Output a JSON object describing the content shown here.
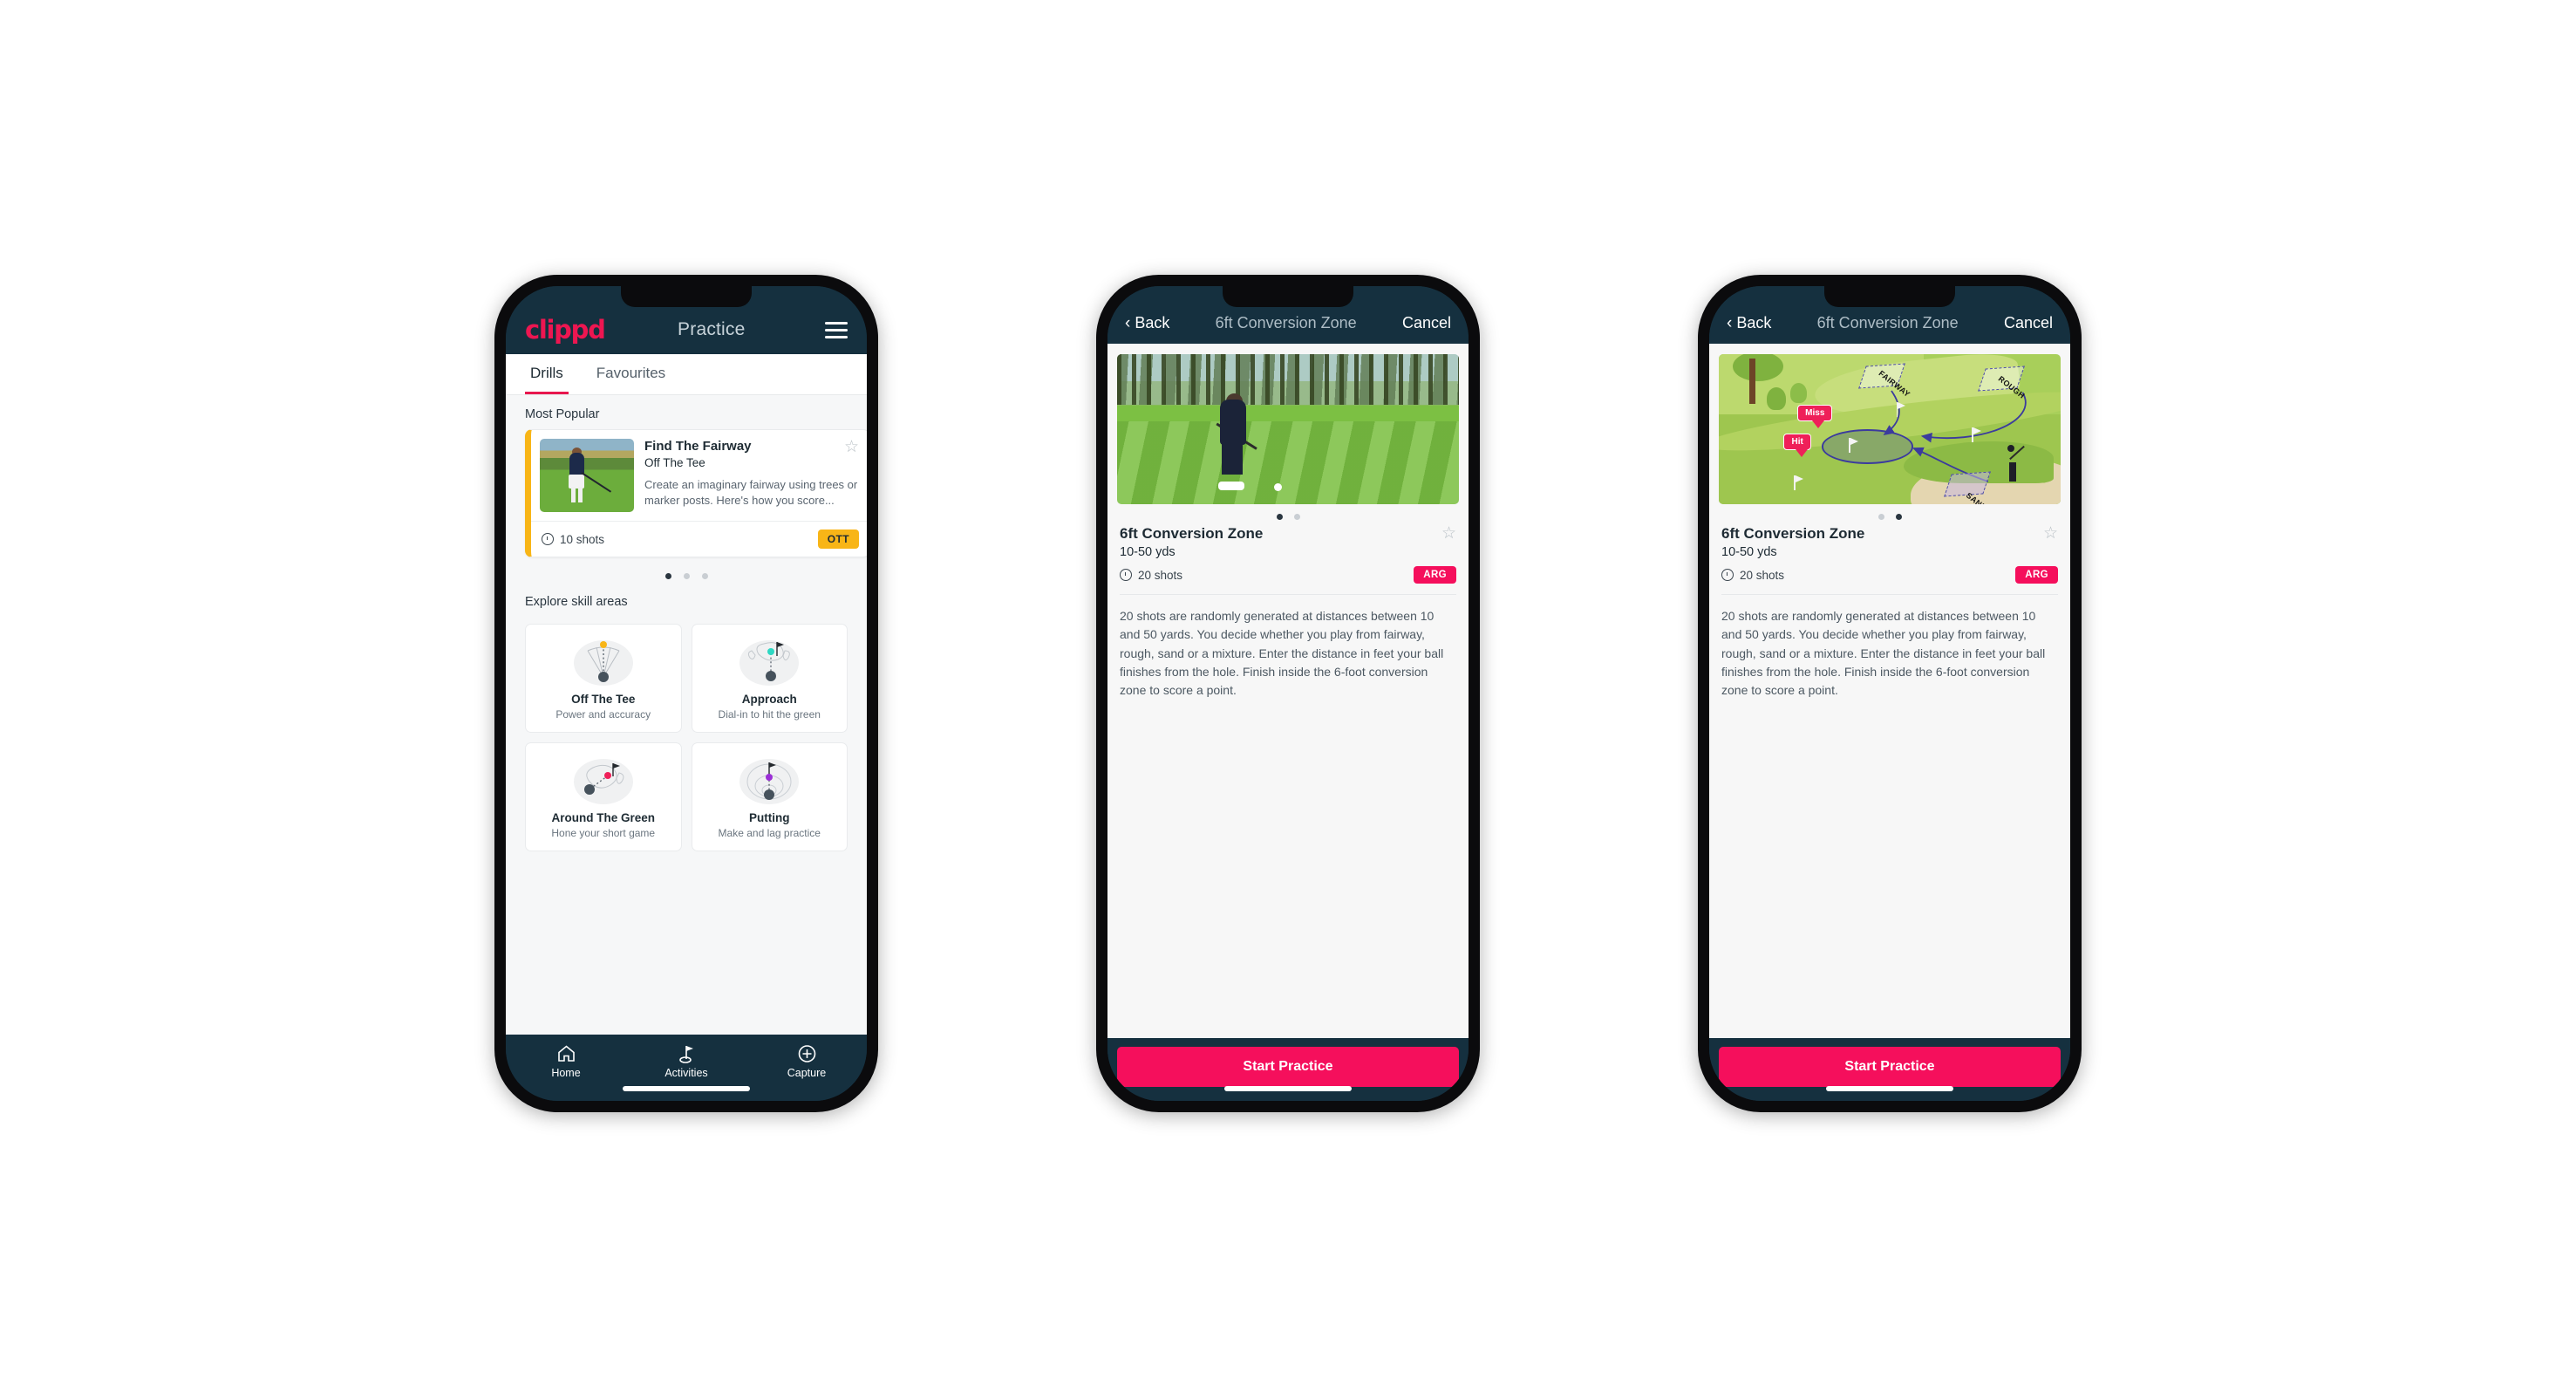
{
  "phone1": {
    "header": {
      "logo": "clippd",
      "title": "Practice",
      "menu_icon": "hamburger-menu-icon"
    },
    "tabs": [
      {
        "label": "Drills",
        "active": true
      },
      {
        "label": "Favourites",
        "active": false
      }
    ],
    "most_popular_label": "Most Popular",
    "drill_card": {
      "title": "Find The Fairway",
      "subtitle": "Off The Tee",
      "description": "Create an imaginary fairway using trees or marker posts. Here's how you score...",
      "shots": "10 shots",
      "badge": "OTT",
      "badge_color": "#F8B517",
      "star_icon": "star-outline-icon",
      "clock_icon": "clock-icon"
    },
    "carousel_dots": {
      "count": 3,
      "active_index": 0
    },
    "explore_label": "Explore skill areas",
    "skills": [
      {
        "name": "Off The Tee",
        "desc": "Power and accuracy",
        "icon": "tee-fan-icon",
        "accent": "#F8B517"
      },
      {
        "name": "Approach",
        "desc": "Dial-in to hit the green",
        "icon": "approach-green-icon",
        "accent": "#2DD8C3"
      },
      {
        "name": "Around The Green",
        "desc": "Hone your short game",
        "icon": "around-green-icon",
        "accent": "#EF2059"
      },
      {
        "name": "Putting",
        "desc": "Make and lag practice",
        "icon": "putting-rings-icon",
        "accent": "#9B2FD6"
      }
    ],
    "tabbar": [
      {
        "label": "Home",
        "icon": "home-icon",
        "active": false
      },
      {
        "label": "Activities",
        "icon": "golf-flag-icon",
        "active": true
      },
      {
        "label": "Capture",
        "icon": "plus-circle-icon",
        "active": false
      }
    ]
  },
  "phone2": {
    "header": {
      "back": "Back",
      "title": "6ft Conversion Zone",
      "cancel": "Cancel",
      "back_icon": "chevron-left-icon"
    },
    "media_type": "photo",
    "dots": {
      "count": 2,
      "active_index": 0
    },
    "name": "6ft Conversion Zone",
    "yards": "10-50 yds",
    "shots": "20 shots",
    "badge": "ARG",
    "badge_color": "#F50F5C",
    "star_icon": "star-outline-icon",
    "clock_icon": "clock-icon",
    "description": "20 shots are randomly generated at distances between 10 and 50 yards. You decide whether you play from fairway, rough, sand or a mixture. Enter the distance in feet your ball finishes from the hole. Finish inside the 6-foot conversion zone to score a point.",
    "cta": "Start Practice"
  },
  "phone3": {
    "header": {
      "back": "Back",
      "title": "6ft Conversion Zone",
      "cancel": "Cancel",
      "back_icon": "chevron-left-icon"
    },
    "media_type": "illustration",
    "illustration": {
      "zones": [
        "FAIRWAY",
        "ROUGH",
        "SAND"
      ],
      "tags": [
        "Miss",
        "Hit"
      ],
      "tag_color": "#EF2059"
    },
    "dots": {
      "count": 2,
      "active_index": 1
    },
    "name": "6ft Conversion Zone",
    "yards": "10-50 yds",
    "shots": "20 shots",
    "badge": "ARG",
    "badge_color": "#F50F5C",
    "star_icon": "star-outline-icon",
    "clock_icon": "clock-icon",
    "description": "20 shots are randomly generated at distances between 10 and 50 yards. You decide whether you play from fairway, rough, sand or a mixture. Enter the distance in feet your ball finishes from the hole. Finish inside the 6-foot conversion zone to score a point.",
    "cta": "Start Practice"
  },
  "theme": {
    "dark_navy": "#15303f",
    "pink": "#F50F5C",
    "logo_pink": "#ED1651",
    "amber": "#F8B517",
    "teal": "#2DD8C3"
  }
}
